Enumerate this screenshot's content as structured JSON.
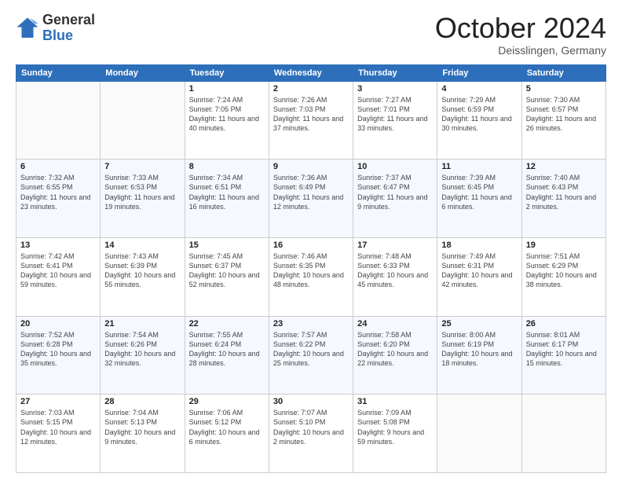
{
  "header": {
    "logo_general": "General",
    "logo_blue": "Blue",
    "month_title": "October 2024",
    "location": "Deisslingen, Germany"
  },
  "days_of_week": [
    "Sunday",
    "Monday",
    "Tuesday",
    "Wednesday",
    "Thursday",
    "Friday",
    "Saturday"
  ],
  "weeks": [
    [
      {
        "day": "",
        "info": ""
      },
      {
        "day": "",
        "info": ""
      },
      {
        "day": "1",
        "info": "Sunrise: 7:24 AM\nSunset: 7:05 PM\nDaylight: 11 hours and 40 minutes."
      },
      {
        "day": "2",
        "info": "Sunrise: 7:26 AM\nSunset: 7:03 PM\nDaylight: 11 hours and 37 minutes."
      },
      {
        "day": "3",
        "info": "Sunrise: 7:27 AM\nSunset: 7:01 PM\nDaylight: 11 hours and 33 minutes."
      },
      {
        "day": "4",
        "info": "Sunrise: 7:29 AM\nSunset: 6:59 PM\nDaylight: 11 hours and 30 minutes."
      },
      {
        "day": "5",
        "info": "Sunrise: 7:30 AM\nSunset: 6:57 PM\nDaylight: 11 hours and 26 minutes."
      }
    ],
    [
      {
        "day": "6",
        "info": "Sunrise: 7:32 AM\nSunset: 6:55 PM\nDaylight: 11 hours and 23 minutes."
      },
      {
        "day": "7",
        "info": "Sunrise: 7:33 AM\nSunset: 6:53 PM\nDaylight: 11 hours and 19 minutes."
      },
      {
        "day": "8",
        "info": "Sunrise: 7:34 AM\nSunset: 6:51 PM\nDaylight: 11 hours and 16 minutes."
      },
      {
        "day": "9",
        "info": "Sunrise: 7:36 AM\nSunset: 6:49 PM\nDaylight: 11 hours and 12 minutes."
      },
      {
        "day": "10",
        "info": "Sunrise: 7:37 AM\nSunset: 6:47 PM\nDaylight: 11 hours and 9 minutes."
      },
      {
        "day": "11",
        "info": "Sunrise: 7:39 AM\nSunset: 6:45 PM\nDaylight: 11 hours and 6 minutes."
      },
      {
        "day": "12",
        "info": "Sunrise: 7:40 AM\nSunset: 6:43 PM\nDaylight: 11 hours and 2 minutes."
      }
    ],
    [
      {
        "day": "13",
        "info": "Sunrise: 7:42 AM\nSunset: 6:41 PM\nDaylight: 10 hours and 59 minutes."
      },
      {
        "day": "14",
        "info": "Sunrise: 7:43 AM\nSunset: 6:39 PM\nDaylight: 10 hours and 55 minutes."
      },
      {
        "day": "15",
        "info": "Sunrise: 7:45 AM\nSunset: 6:37 PM\nDaylight: 10 hours and 52 minutes."
      },
      {
        "day": "16",
        "info": "Sunrise: 7:46 AM\nSunset: 6:35 PM\nDaylight: 10 hours and 48 minutes."
      },
      {
        "day": "17",
        "info": "Sunrise: 7:48 AM\nSunset: 6:33 PM\nDaylight: 10 hours and 45 minutes."
      },
      {
        "day": "18",
        "info": "Sunrise: 7:49 AM\nSunset: 6:31 PM\nDaylight: 10 hours and 42 minutes."
      },
      {
        "day": "19",
        "info": "Sunrise: 7:51 AM\nSunset: 6:29 PM\nDaylight: 10 hours and 38 minutes."
      }
    ],
    [
      {
        "day": "20",
        "info": "Sunrise: 7:52 AM\nSunset: 6:28 PM\nDaylight: 10 hours and 35 minutes."
      },
      {
        "day": "21",
        "info": "Sunrise: 7:54 AM\nSunset: 6:26 PM\nDaylight: 10 hours and 32 minutes."
      },
      {
        "day": "22",
        "info": "Sunrise: 7:55 AM\nSunset: 6:24 PM\nDaylight: 10 hours and 28 minutes."
      },
      {
        "day": "23",
        "info": "Sunrise: 7:57 AM\nSunset: 6:22 PM\nDaylight: 10 hours and 25 minutes."
      },
      {
        "day": "24",
        "info": "Sunrise: 7:58 AM\nSunset: 6:20 PM\nDaylight: 10 hours and 22 minutes."
      },
      {
        "day": "25",
        "info": "Sunrise: 8:00 AM\nSunset: 6:19 PM\nDaylight: 10 hours and 18 minutes."
      },
      {
        "day": "26",
        "info": "Sunrise: 8:01 AM\nSunset: 6:17 PM\nDaylight: 10 hours and 15 minutes."
      }
    ],
    [
      {
        "day": "27",
        "info": "Sunrise: 7:03 AM\nSunset: 5:15 PM\nDaylight: 10 hours and 12 minutes."
      },
      {
        "day": "28",
        "info": "Sunrise: 7:04 AM\nSunset: 5:13 PM\nDaylight: 10 hours and 9 minutes."
      },
      {
        "day": "29",
        "info": "Sunrise: 7:06 AM\nSunset: 5:12 PM\nDaylight: 10 hours and 6 minutes."
      },
      {
        "day": "30",
        "info": "Sunrise: 7:07 AM\nSunset: 5:10 PM\nDaylight: 10 hours and 2 minutes."
      },
      {
        "day": "31",
        "info": "Sunrise: 7:09 AM\nSunset: 5:08 PM\nDaylight: 9 hours and 59 minutes."
      },
      {
        "day": "",
        "info": ""
      },
      {
        "day": "",
        "info": ""
      }
    ]
  ]
}
